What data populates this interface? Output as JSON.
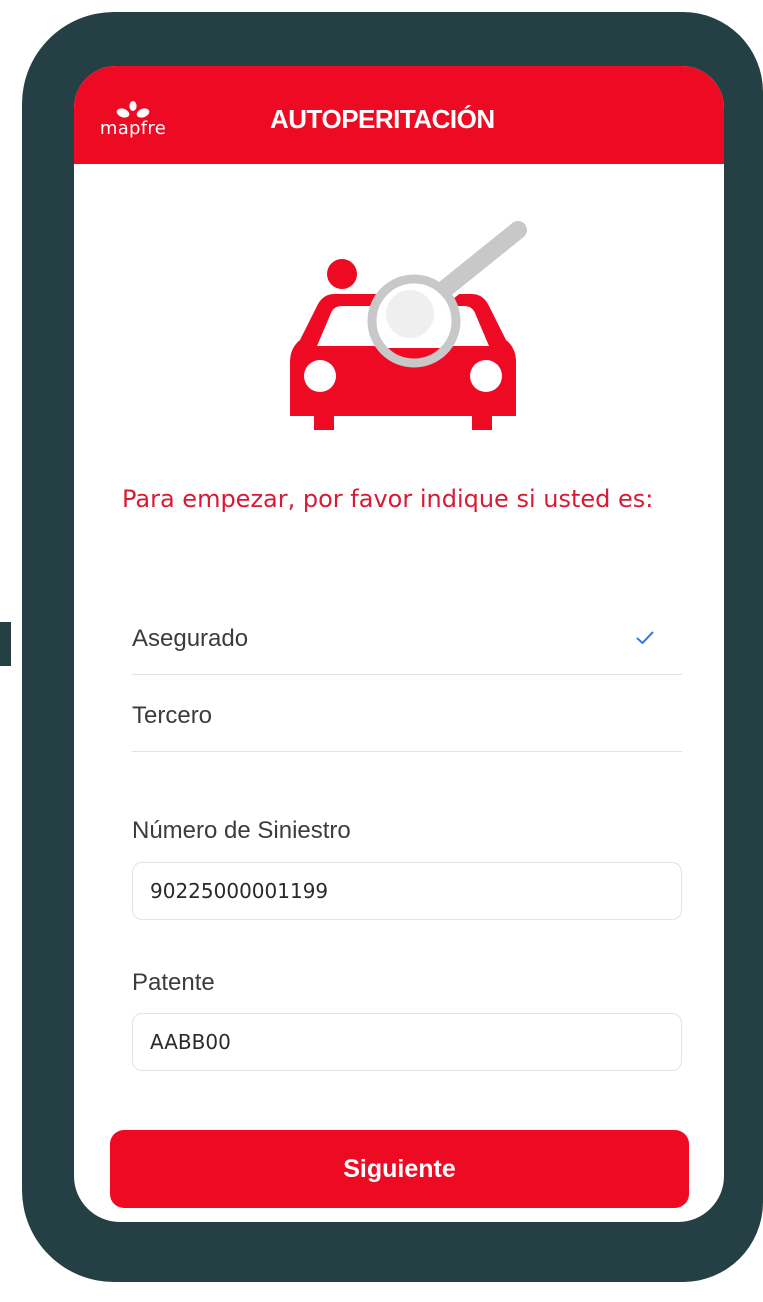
{
  "header": {
    "brand_name": "mapfre",
    "title": "AUTOPERITACIÓN"
  },
  "hero": {
    "icon": "car-inspection-icon"
  },
  "intro": {
    "text": "Para empezar, por favor indique si usted es:"
  },
  "role_options": [
    {
      "label": "Asegurado",
      "selected": true
    },
    {
      "label": "Tercero",
      "selected": false
    }
  ],
  "form": {
    "claim_number": {
      "label": "Número de Siniestro",
      "value": "90225000001199"
    },
    "plate": {
      "label": "Patente",
      "value": "AABB00"
    }
  },
  "actions": {
    "next_label": "Siguiente"
  },
  "colors": {
    "brand_red": "#ef0a23",
    "frame": "#244044",
    "intro_text": "#d91a35",
    "check": "#2f7bea"
  }
}
